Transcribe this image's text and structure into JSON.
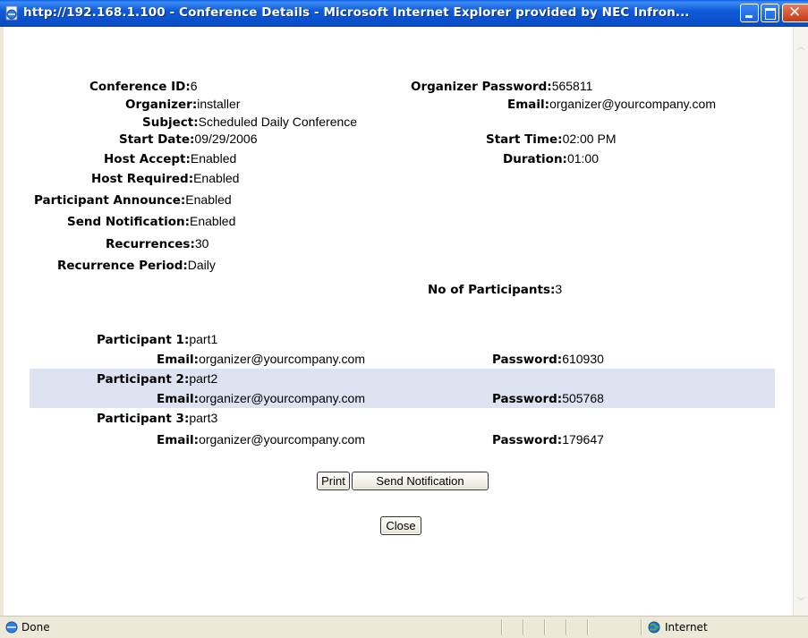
{
  "window": {
    "title": "http://192.168.1.100 - Conference Details - Microsoft Internet Explorer provided by NEC Infron...",
    "icon": "ie-page-icon"
  },
  "conference": {
    "conference_id": {
      "label": "Conference ID:",
      "value": "6"
    },
    "organizer_password": {
      "label": "Organizer Password:",
      "value": "565811"
    },
    "organizer": {
      "label": "Organizer:",
      "value": "installer"
    },
    "email": {
      "label": "Email:",
      "value": "organizer@yourcompany.com"
    },
    "subject": {
      "label": "Subject:",
      "value": "Scheduled Daily Conference"
    },
    "start_date": {
      "label": "Start Date:",
      "value": "09/29/2006"
    },
    "start_time": {
      "label": "Start Time:",
      "value": "02:00 PM"
    },
    "host_accept": {
      "label": "Host Accept:",
      "value": "Enabled"
    },
    "duration": {
      "label": "Duration:",
      "value": "01:00"
    },
    "host_required": {
      "label": "Host Required:",
      "value": "Enabled"
    },
    "participant_announce": {
      "label": "Participant Announce:",
      "value": "Enabled"
    },
    "send_notification": {
      "label": "Send Notification:",
      "value": "Enabled"
    },
    "recurrences": {
      "label": "Recurrences:",
      "value": "30"
    },
    "recurrence_period": {
      "label": "Recurrence Period:",
      "value": "Daily"
    },
    "no_of_participants": {
      "label": "No of Participants:",
      "value": "3"
    }
  },
  "participants": [
    {
      "label": "Participant 1:",
      "name": "part1",
      "email_label": "Email:",
      "email": "organizer@yourcompany.com",
      "password_label": "Password:",
      "password": "610930"
    },
    {
      "label": "Participant 2:",
      "name": "part2",
      "email_label": "Email:",
      "email": "organizer@yourcompany.com",
      "password_label": "Password:",
      "password": "505768"
    },
    {
      "label": "Participant 3:",
      "name": "part3",
      "email_label": "Email:",
      "email": "organizer@yourcompany.com",
      "password_label": "Password:",
      "password": "179647"
    }
  ],
  "buttons": {
    "print": "Print",
    "send_notification": "Send Notification",
    "close": "Close"
  },
  "status": {
    "text": "Done",
    "zone": "Internet",
    "zone_icon": "globe-icon"
  },
  "colors": {
    "highlight_row": "#dde3f0",
    "titlebar": "#0a4ec9"
  }
}
